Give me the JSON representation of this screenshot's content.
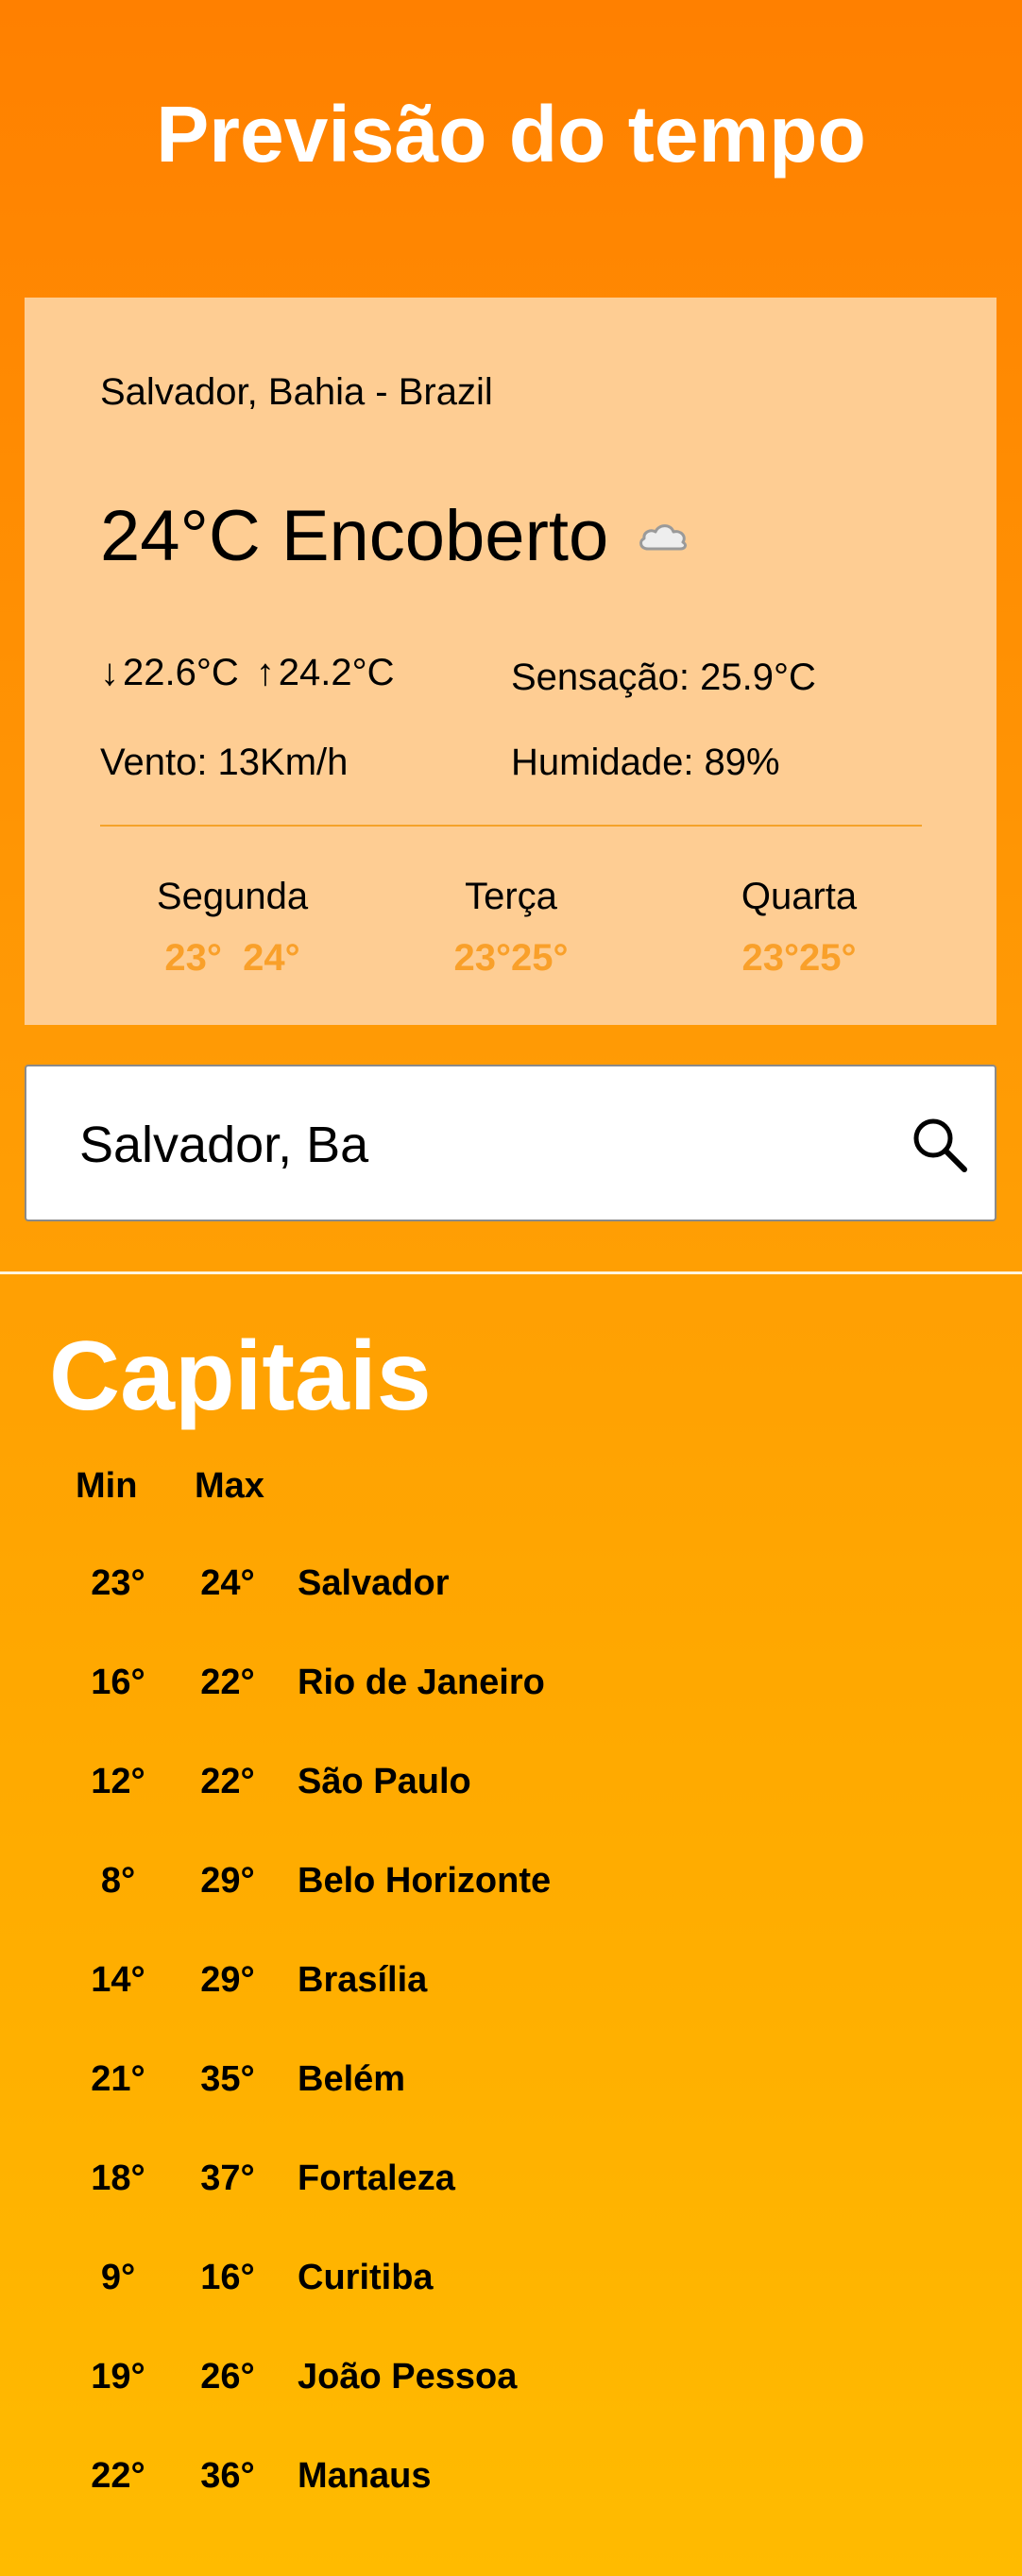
{
  "header": {
    "title": "Previsão do tempo"
  },
  "weather": {
    "location": "Salvador, Bahia - Brazil",
    "current_temp": "24°C",
    "condition": "Encoberto",
    "condition_icon": "cloud-icon",
    "min_arrow": "↓",
    "min": "22.6°C",
    "max_arrow": "↑",
    "max": "24.2°C",
    "feels_like": "Sensação: 25.9°C",
    "wind": "Vento: 13Km/h",
    "humidity": "Humidade: 89%",
    "forecast": [
      {
        "day": "Segunda",
        "temps": "23°  24°"
      },
      {
        "day": "Terça",
        "temps": "23°25°"
      },
      {
        "day": "Quarta",
        "temps": "23°25°"
      }
    ]
  },
  "search": {
    "value": "Salvador, Ba",
    "icon": "search-icon"
  },
  "capitals": {
    "title": "Capitais",
    "min_header": "Min",
    "max_header": "Max",
    "rows": [
      {
        "min": "23°",
        "max": "24°",
        "city": "Salvador"
      },
      {
        "min": "16°",
        "max": "22°",
        "city": "Rio de Janeiro"
      },
      {
        "min": "12°",
        "max": "22°",
        "city": "São Paulo"
      },
      {
        "min": "8°",
        "max": "29°",
        "city": "Belo Horizonte"
      },
      {
        "min": "14°",
        "max": "29°",
        "city": "Brasília"
      },
      {
        "min": "21°",
        "max": "35°",
        "city": "Belém"
      },
      {
        "min": "18°",
        "max": "37°",
        "city": "Fortaleza"
      },
      {
        "min": "9°",
        "max": "16°",
        "city": "Curitiba"
      },
      {
        "min": "19°",
        "max": "26°",
        "city": "João Pessoa"
      },
      {
        "min": "22°",
        "max": "36°",
        "city": "Manaus"
      }
    ]
  },
  "colors": {
    "accent": "#ff8c00",
    "card": "#fecd93",
    "forecast_temp": "#f9a02a"
  }
}
